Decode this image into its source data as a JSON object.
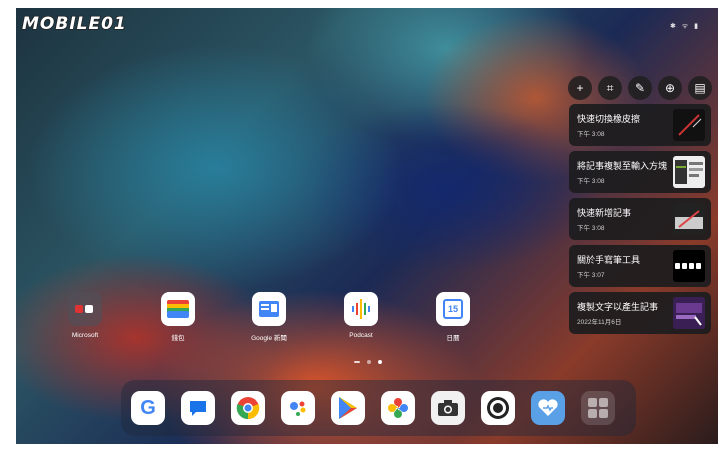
{
  "logo": {
    "text": "MOBILE01",
    "badge": "01"
  },
  "status_bar": {
    "icons": "✱ ᯤ ▮"
  },
  "toolbar": [
    {
      "name": "add-icon",
      "glyph": "+"
    },
    {
      "name": "crop-icon",
      "glyph": "⌗"
    },
    {
      "name": "pen-icon",
      "glyph": "✎"
    },
    {
      "name": "zoom-icon",
      "glyph": "⊕"
    },
    {
      "name": "clipboard-icon",
      "glyph": "▤"
    }
  ],
  "notes": [
    {
      "title": "快速切換橡皮擦",
      "time": "下午 3:08"
    },
    {
      "title": "將記事複製至輸入方塊",
      "time": "下午 3:08"
    },
    {
      "title": "快速新增記事",
      "time": "下午 3:08"
    },
    {
      "title": "關於手寫筆工具",
      "time": "下午 3:07"
    },
    {
      "title": "複製文字以產生記事",
      "time": "2022年11月6日"
    }
  ],
  "home_apps": [
    {
      "label": "Microsoft"
    },
    {
      "label": "錢包"
    },
    {
      "label": "Google 新聞"
    },
    {
      "label": "Podcast"
    },
    {
      "label": "日曆",
      "glyph": "15"
    }
  ],
  "dock_apps": [
    {
      "name": "google",
      "glyph": "G"
    },
    {
      "name": "messages",
      "glyph": "💬"
    },
    {
      "name": "chrome",
      "glyph": "◉"
    },
    {
      "name": "assistant",
      "glyph": "●"
    },
    {
      "name": "play-store",
      "glyph": "▶"
    },
    {
      "name": "photos",
      "glyph": "✿"
    },
    {
      "name": "camera",
      "glyph": "📷"
    },
    {
      "name": "settings",
      "glyph": "⚙"
    },
    {
      "name": "health",
      "glyph": "♥"
    },
    {
      "name": "app-drawer",
      "glyph": "▦"
    }
  ],
  "colors": {
    "note_bg": "#1c1c1e",
    "accent_blue": "#4285f4"
  }
}
